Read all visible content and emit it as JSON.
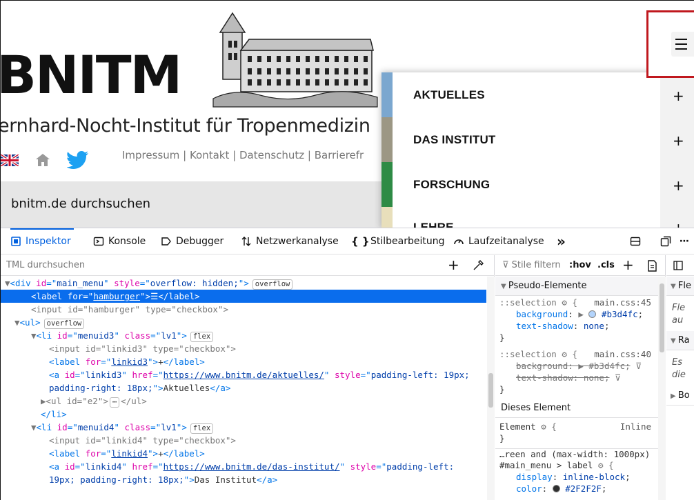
{
  "site": {
    "logo_text": "BNITM",
    "institute_name": "ernhard-Nocht-Institut für Tropenmedizin",
    "links_text": "Impressum | Kontakt | Datenschutz | Barrierefr",
    "search_label": "bnitm.de durchsuchen",
    "menu_items": [
      {
        "label": "AKTUELLES",
        "color": "#7ba7cf",
        "toggle": "+"
      },
      {
        "label": "DAS INSTITUT",
        "color": "#9c9784",
        "toggle": "+"
      },
      {
        "label": "FORSCHUNG",
        "color": "#2e8b45",
        "toggle": "+"
      },
      {
        "label": "LEHRE",
        "color": "#e8dfbb",
        "toggle": "+"
      }
    ],
    "hamburger_glyph": "☰"
  },
  "devtools": {
    "tabs": [
      {
        "label": "Inspektor",
        "icon": "inspector-icon"
      },
      {
        "label": "Konsole",
        "icon": "console-icon"
      },
      {
        "label": "Debugger",
        "icon": "debugger-icon"
      },
      {
        "label": "Netzwerkanalyse",
        "icon": "network-icon"
      },
      {
        "label": "Stilbearbeitung",
        "icon": "style-editor-icon"
      },
      {
        "label": "Laufzeitanalyse",
        "icon": "performance-icon"
      }
    ],
    "more_tabs": "»",
    "markup_search_placeholder": "TML durchsuchen",
    "markup": {
      "l1_id": "main_menu",
      "l1_style": "overflow: hidden;",
      "badge_overflow": "overflow",
      "badge_flex": "flex",
      "l2_for": "hamburger",
      "l2_text": "☰",
      "l3_id": "hamburger",
      "l3_type": "checkbox",
      "li3_id": "menuid3",
      "li_class": "lv1",
      "in3_id": "linkid3",
      "lb3_for": "linkid3",
      "lb_text": "+",
      "a3_id": "linkid3",
      "a3_href": "https://www.bnitm.de/aktuelles/",
      "a3_style1": "padding-left: 19px;",
      "a3_style2": "padding-right: 18px;",
      "a3_text": "Aktuelles",
      "ul_id": "e2",
      "li4_id": "menuid4",
      "in4_id": "linkid4",
      "lb4_for": "linkid4",
      "a4_id": "linkid4",
      "a4_href": "https://www.bnitm.de/das-institut/",
      "a4_style1": "padding-left:",
      "a4_style2": "19px; padding-right: 18px;",
      "a4_text": "Das Institut"
    },
    "rules": {
      "filter_placeholder": "Stile filtern",
      "hov": ":hov",
      "cls": ".cls",
      "pseudo_header": "Pseudo-Elemente",
      "sel1": "::selection",
      "src1": "main.css:45",
      "bg_prop": "background",
      "bg_val": "#b3d4fc",
      "ts_prop": "text-shadow",
      "ts_val": "none",
      "sel2": "::selection",
      "src2": "main.css:40",
      "this_element": "Dieses Element",
      "element_label": "Element",
      "inline_label": "Inline",
      "media": "…reen and (max-width: 1000px)",
      "selector3": "#main_menu > label",
      "display_prop": "display",
      "display_val": "inline-block",
      "color_prop": "color",
      "color_val": "#2F2F2F"
    },
    "layout_panel": {
      "h1": "Fle",
      "t1": "Fle",
      "t2": "au",
      "h2": "Ra",
      "t3": "Es",
      "t4": "die",
      "h3": "Bo"
    }
  }
}
